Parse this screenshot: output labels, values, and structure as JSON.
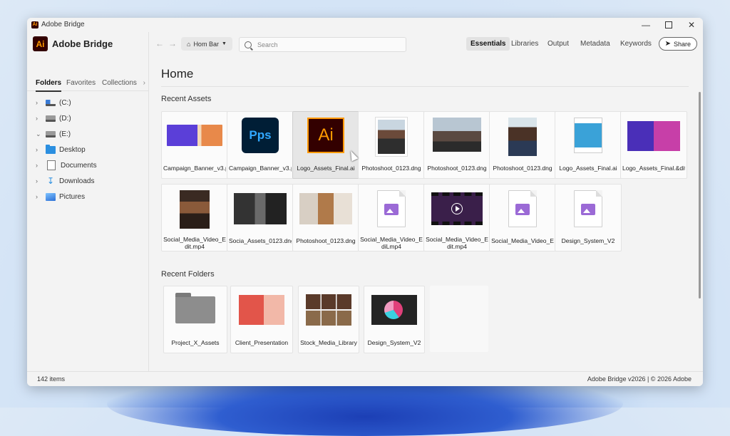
{
  "window": {
    "title": "Adobe Bridge"
  },
  "brand": {
    "logo_text": "Ai",
    "name": "Adobe Bridge",
    "accent": "#ff9a00",
    "logo_bg": "#330000"
  },
  "sidebar": {
    "tabs": [
      "Folders",
      "Favorites",
      "Collections"
    ],
    "active_tab": "Folders",
    "tree": [
      {
        "label": "(C:)",
        "icon": "drive-icon",
        "expanded": false
      },
      {
        "label": "(D:)",
        "icon": "drive-icon",
        "expanded": false
      },
      {
        "label": "(E:)",
        "icon": "drive-icon",
        "expanded": true
      },
      {
        "label": "Desktop",
        "icon": "folder-icon",
        "expanded": false
      },
      {
        "label": "Documents",
        "icon": "document-icon",
        "expanded": false
      },
      {
        "label": "Downloads",
        "icon": "download-icon",
        "expanded": false
      },
      {
        "label": "Pictures",
        "icon": "pictures-icon",
        "expanded": false
      }
    ]
  },
  "toolbar": {
    "breadcrumb": "Hom Bar",
    "search_placeholder": "Search",
    "workspaces": [
      "Essentials",
      "Libraries",
      "Output",
      "Metadata",
      "Keywords"
    ],
    "active_workspace": "Essentials",
    "share_label": "Share"
  },
  "main": {
    "title": "Home",
    "recent_assets_label": "Recent Assets",
    "recent_folders_label": "Recent Folders",
    "recent_assets": [
      {
        "name": "Campaign_Banner_v3.psd",
        "thumb": "banner"
      },
      {
        "name": "Campaign_Banner_v3.ps",
        "thumb": "photoshop",
        "thumb_text": "Pps"
      },
      {
        "name": "Logo_Assets_Final.ai",
        "thumb": "illustrator",
        "thumb_text": "Ai",
        "selected": true
      },
      {
        "name": "Photoshoot_0123.dng",
        "thumb": "photo-1"
      },
      {
        "name": "Photoshoot_0123.dng",
        "thumb": "photo-2"
      },
      {
        "name": "Photoshoot_0123.dng",
        "thumb": "photo-3"
      },
      {
        "name": "Logo_Assets_Final.ai",
        "thumb": "document"
      },
      {
        "name": "Logo_Assets_Final.&dit",
        "thumb": "web"
      },
      {
        "name": "Social_Media_Video_Edit.mp4",
        "thumb": "photo-4"
      },
      {
        "name": "Socia_Assets_0123.dng",
        "thumb": "photo-5"
      },
      {
        "name": "Photoshoot_0123.dng",
        "thumb": "photo-6"
      },
      {
        "name": "Social_Media_Video_EdiLmp4",
        "thumb": "image-file"
      },
      {
        "name": "Social_Media_Video_Edit.mp4",
        "thumb": "video"
      },
      {
        "name": "Social_Media_Video_E",
        "thumb": "image-file"
      },
      {
        "name": "Design_System_V2",
        "thumb": "image-file"
      }
    ],
    "recent_folders": [
      {
        "name": "Project_X_Assets",
        "thumb": "folder"
      },
      {
        "name": "Client_Presentation",
        "thumb": "presentation"
      },
      {
        "name": "Stock_Media_Library",
        "thumb": "stock"
      },
      {
        "name": "Design_System_V2",
        "thumb": "design"
      }
    ]
  },
  "status": {
    "items_count": "142 items",
    "version": "Adobe Bridge v2026 | © 2026 Adobe"
  }
}
